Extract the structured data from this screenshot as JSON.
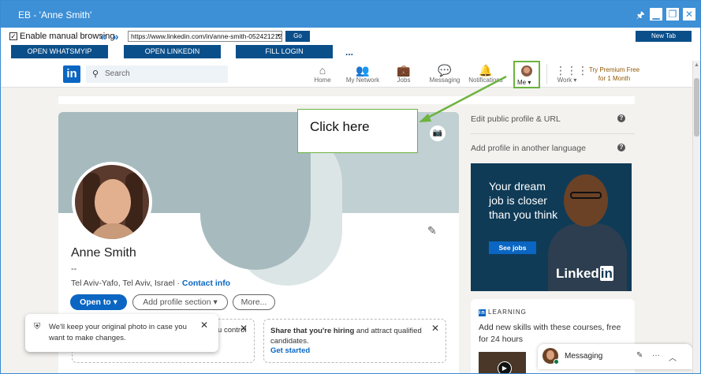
{
  "window": {
    "title": "EB - 'Anne Smith'"
  },
  "toolbar": {
    "manual_browsing_label": "Enable manual browsing",
    "back_label": "«",
    "forward_label": "»",
    "url": "https://www.linkedin.com/in/anne-smith-052421212",
    "go_label": "Go",
    "new_tab_label": "New Tab",
    "open_whatsmyip_label": "OPEN WHATSMYIP",
    "open_linkedin_label": "OPEN LINKEDIN",
    "fill_login_label": "FILL LOGIN",
    "more_label": "..."
  },
  "linkedin": {
    "logo_text": "in",
    "search_placeholder": "Search",
    "nav": {
      "home": "Home",
      "network": "My Network",
      "jobs": "Jobs",
      "messaging": "Messaging",
      "notifications": "Notifications",
      "me": "Me",
      "work": "Work"
    },
    "premium_line1": "Try Premium Free",
    "premium_line2": "for 1 Month"
  },
  "profile": {
    "name": "Anne Smith",
    "headline": "--",
    "location": "Tel Aviv-Yafo, Tel Aviv, Israel",
    "separator": "·",
    "contact_info": "Contact info",
    "open_to": "Open to",
    "add_section": "Add profile section",
    "more": "More...",
    "card1_text": "Show recruiters you're open to work — you control who sees this.",
    "card2_bold": "Share that you're hiring",
    "card2_rest": " and attract qualified candidates.",
    "card2_link": "Get started"
  },
  "toast": {
    "text": "We'll keep your original photo in case you want to make changes."
  },
  "sidebar": {
    "edit_profile_url": "Edit public profile & URL",
    "add_language": "Add profile in another language",
    "ad_text": "Your dream job is closer than you think",
    "ad_button": "See jobs",
    "ad_brand": "Linked",
    "ad_brand_in": "in",
    "learning_header": "LEARNING",
    "learning_title": "Add new skills with these courses, free for 24 hours"
  },
  "messaging": {
    "label": "Messaging"
  },
  "callout": {
    "text": "Click here"
  },
  "colors": {
    "accent": "#0a66c2",
    "frame": "#3d8fd6",
    "button_dark": "#0b4f8a",
    "highlight": "#6cb33f"
  }
}
